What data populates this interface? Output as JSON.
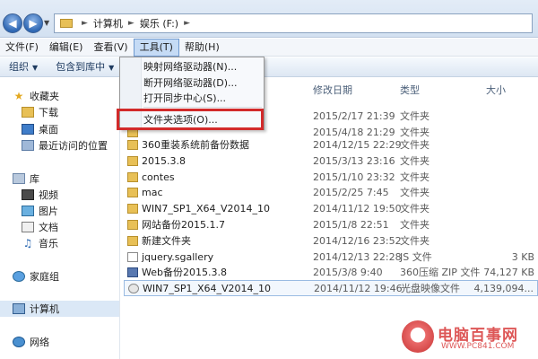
{
  "address_bar": {
    "breadcrumbs": [
      "计算机",
      "娱乐 (F:)"
    ]
  },
  "menubar": {
    "items": [
      "文件(F)",
      "编辑(E)",
      "查看(V)",
      "工具(T)",
      "帮助(H)"
    ],
    "active": "工具(T)"
  },
  "toolbar": {
    "organize": "组织",
    "include_in_library": "包含到库中"
  },
  "tools_menu": {
    "items": [
      "映射网络驱动器(N)...",
      "断开网络驱动器(D)...",
      "打开同步中心(S)...",
      "文件夹选项(O)..."
    ],
    "highlighted": "文件夹选项(O)..."
  },
  "navpane": {
    "favorites": "收藏夹",
    "downloads": "下载",
    "desktop": "桌面",
    "recent": "最近访问的位置",
    "libraries": "库",
    "videos": "视频",
    "pictures": "图片",
    "documents": "文档",
    "music": "音乐",
    "homegroup": "家庭组",
    "computer": "计算机",
    "network": "网络"
  },
  "columns": {
    "date": "修改日期",
    "type": "类型",
    "size": "大小"
  },
  "files": [
    {
      "name": "",
      "date": "2015/2/17 21:39",
      "type": "文件夹",
      "size": "",
      "icon": "folder"
    },
    {
      "name": "",
      "date": "2015/4/18 21:29",
      "type": "文件夹",
      "size": "",
      "icon": "folder"
    },
    {
      "name": "360重装系统前备份数据",
      "date": "2014/12/15 22:29",
      "type": "文件夹",
      "size": "",
      "icon": "folder"
    },
    {
      "name": "2015.3.8",
      "date": "2015/3/13 23:16",
      "type": "文件夹",
      "size": "",
      "icon": "folder"
    },
    {
      "name": "contes",
      "date": "2015/1/10 23:32",
      "type": "文件夹",
      "size": "",
      "icon": "folder"
    },
    {
      "name": "mac",
      "date": "2015/2/25 7:45",
      "type": "文件夹",
      "size": "",
      "icon": "folder"
    },
    {
      "name": "WIN7_SP1_X64_V2014_10",
      "date": "2014/11/12 19:50",
      "type": "文件夹",
      "size": "",
      "icon": "folder"
    },
    {
      "name": "网站备份2015.1.7",
      "date": "2015/1/8 22:51",
      "type": "文件夹",
      "size": "",
      "icon": "folder"
    },
    {
      "name": "新建文件夹",
      "date": "2014/12/16 23:52",
      "type": "文件夹",
      "size": "",
      "icon": "folder"
    },
    {
      "name": "jquery.sgallery",
      "date": "2014/12/13 22:28",
      "type": "JS 文件",
      "size": "3 KB",
      "icon": "js"
    },
    {
      "name": "Web备份2015.3.8",
      "date": "2015/3/8 9:40",
      "type": "360压缩 ZIP 文件",
      "size": "74,127 KB",
      "icon": "zip"
    },
    {
      "name": "WIN7_SP1_X64_V2014_10",
      "date": "2014/11/12 19:46",
      "type": "光盘映像文件",
      "size": "4,139,094...",
      "icon": "iso"
    }
  ],
  "watermark": {
    "text": "电脑百事网",
    "url": "WWW.PC841.COM"
  },
  "colors": {
    "highlight_border": "#d22a2a",
    "selection": "#c5dbf5"
  }
}
